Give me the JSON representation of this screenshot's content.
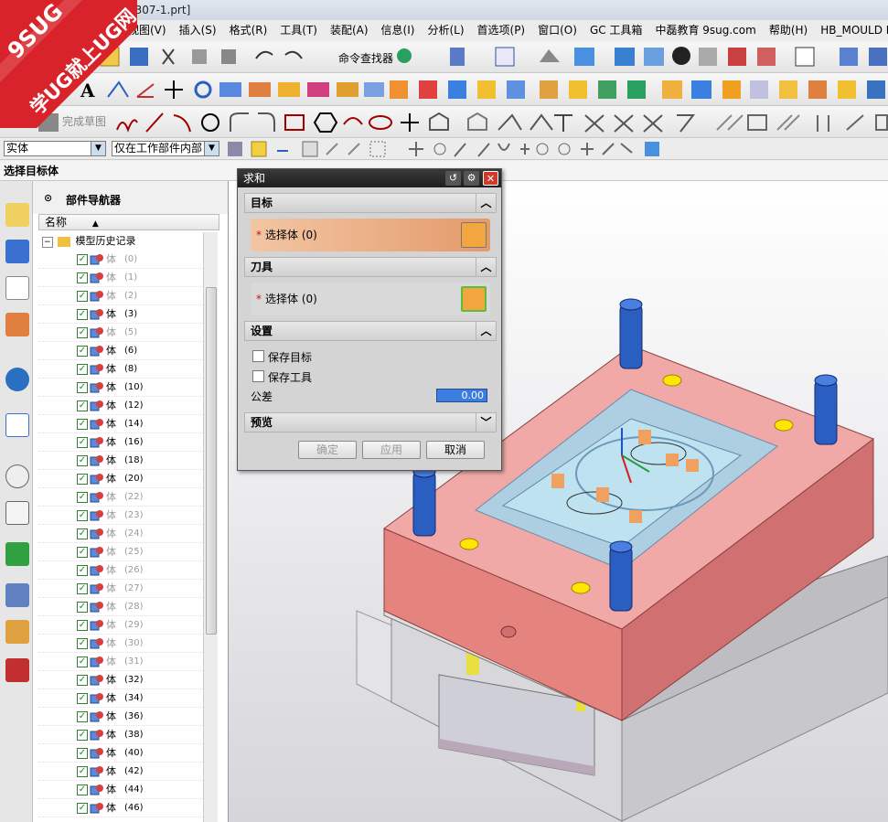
{
  "window": {
    "title_fragment": "0307-1.prt]"
  },
  "menu": [
    "视图(V)",
    "插入(S)",
    "格式(R)",
    "工具(T)",
    "装配(A)",
    "信息(I)",
    "分析(L)",
    "首选项(P)",
    "窗口(O)",
    "GC 工具箱",
    "中磊教育 9sug.com",
    "帮助(H)",
    "HB_MOULD M6.7"
  ],
  "toolbar": {
    "command_finder": "命令查找器",
    "finish_sketch": "完成草图"
  },
  "selection_bar": {
    "filter_type": "实体",
    "scope": "仅在工作部件内部"
  },
  "prompt": "选择目标体",
  "logo": {
    "line1": "9SUG",
    "line2": "学UG就上UG网"
  },
  "navigator": {
    "title": "部件导航器",
    "column_header": "名称",
    "root": "模型历史记录",
    "rows": [
      {
        "label": "体",
        "idx": "(0)",
        "dim": true
      },
      {
        "label": "体",
        "idx": "(1)",
        "dim": true
      },
      {
        "label": "体",
        "idx": "(2)",
        "dim": true
      },
      {
        "label": "体",
        "idx": "(3)",
        "dim": false
      },
      {
        "label": "体",
        "idx": "(5)",
        "dim": true
      },
      {
        "label": "体",
        "idx": "(6)",
        "dim": false
      },
      {
        "label": "体",
        "idx": "(8)",
        "dim": false
      },
      {
        "label": "体",
        "idx": "(10)",
        "dim": false
      },
      {
        "label": "体",
        "idx": "(12)",
        "dim": false
      },
      {
        "label": "体",
        "idx": "(14)",
        "dim": false
      },
      {
        "label": "体",
        "idx": "(16)",
        "dim": false
      },
      {
        "label": "体",
        "idx": "(18)",
        "dim": false
      },
      {
        "label": "体",
        "idx": "(20)",
        "dim": false
      },
      {
        "label": "体",
        "idx": "(22)",
        "dim": true
      },
      {
        "label": "体",
        "idx": "(23)",
        "dim": true
      },
      {
        "label": "体",
        "idx": "(24)",
        "dim": true
      },
      {
        "label": "体",
        "idx": "(25)",
        "dim": true
      },
      {
        "label": "体",
        "idx": "(26)",
        "dim": true
      },
      {
        "label": "体",
        "idx": "(27)",
        "dim": true
      },
      {
        "label": "体",
        "idx": "(28)",
        "dim": true
      },
      {
        "label": "体",
        "idx": "(29)",
        "dim": true
      },
      {
        "label": "体",
        "idx": "(30)",
        "dim": true
      },
      {
        "label": "体",
        "idx": "(31)",
        "dim": true
      },
      {
        "label": "体",
        "idx": "(32)",
        "dim": false
      },
      {
        "label": "体",
        "idx": "(34)",
        "dim": false
      },
      {
        "label": "体",
        "idx": "(36)",
        "dim": false
      },
      {
        "label": "体",
        "idx": "(38)",
        "dim": false
      },
      {
        "label": "体",
        "idx": "(40)",
        "dim": false
      },
      {
        "label": "体",
        "idx": "(42)",
        "dim": false
      },
      {
        "label": "体",
        "idx": "(44)",
        "dim": false
      },
      {
        "label": "体",
        "idx": "(46)",
        "dim": false
      }
    ]
  },
  "dialog": {
    "title": "求和",
    "target_section": "目标",
    "target_select": "选择体 (0)",
    "tool_section": "刀具",
    "tool_select": "选择体 (0)",
    "settings_section": "设置",
    "keep_target": "保存目标",
    "keep_tool": "保存工具",
    "tolerance_label": "公差",
    "tolerance_value": "0.00",
    "preview_section": "预览",
    "ok": "确定",
    "apply": "应用",
    "cancel": "取消"
  },
  "colors": {
    "plate_red": "#e5837e",
    "pin_blue": "#2a5ec0",
    "marker_yellow": "#ffe600",
    "highlight_orange": "#f0a060"
  }
}
